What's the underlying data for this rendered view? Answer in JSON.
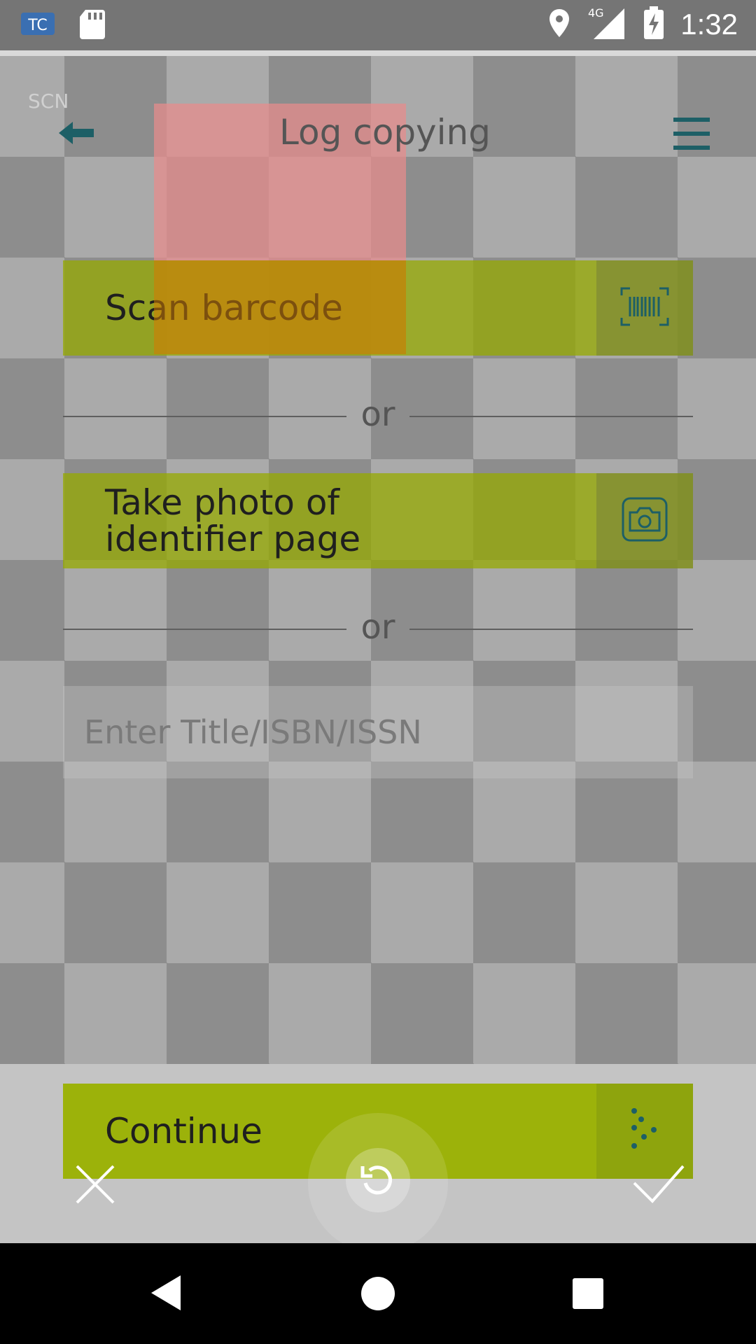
{
  "status_bar": {
    "time": "1:32",
    "network": "4G"
  },
  "header": {
    "small_label": "SCN",
    "title": "Log copying"
  },
  "actions": {
    "scan_label": "Scan barcode",
    "or_label": "or",
    "photo_label_line1": "Take photo of",
    "photo_label_line2": "identifier page",
    "input_placeholder": "Enter Title/ISBN/ISSN"
  },
  "footer": {
    "continue_label": "Continue"
  },
  "colors": {
    "accent": "#9cb20a",
    "icon_teal": "#1d5f66"
  }
}
